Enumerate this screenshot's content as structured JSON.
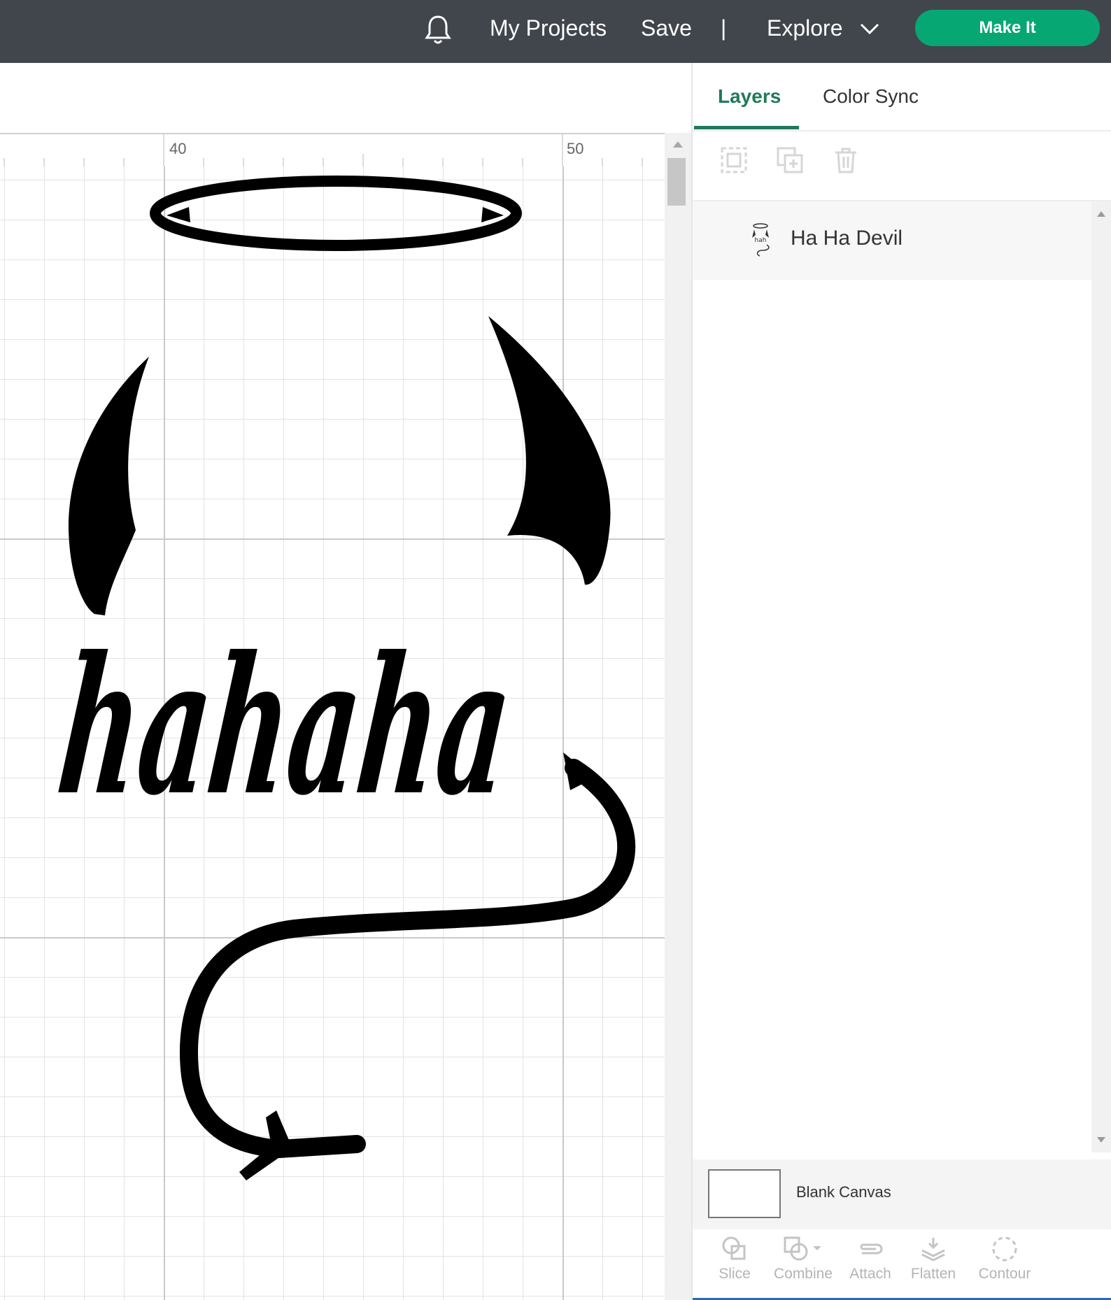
{
  "header": {
    "my_projects": "My Projects",
    "save": "Save",
    "separator": "|",
    "explore": "Explore",
    "make_it": "Make It"
  },
  "ruler": {
    "labels": [
      "40",
      "50"
    ]
  },
  "panel": {
    "tabs": [
      {
        "label": "Layers",
        "active": true
      },
      {
        "label": "Color Sync",
        "active": false
      }
    ],
    "layers": [
      {
        "name": "Ha Ha Devil"
      }
    ],
    "blank_canvas": "Blank Canvas",
    "tools": [
      {
        "label": "Slice",
        "icon": "slice-icon"
      },
      {
        "label": "Combine",
        "icon": "combine-icon"
      },
      {
        "label": "Attach",
        "icon": "attach-icon"
      },
      {
        "label": "Flatten",
        "icon": "flatten-icon"
      },
      {
        "label": "Contour",
        "icon": "contour-icon"
      }
    ]
  },
  "canvas": {
    "design_text": "hahaha"
  },
  "colors": {
    "accent": "#1f7a57",
    "make_it": "#07a774",
    "topbar": "#41464d"
  }
}
